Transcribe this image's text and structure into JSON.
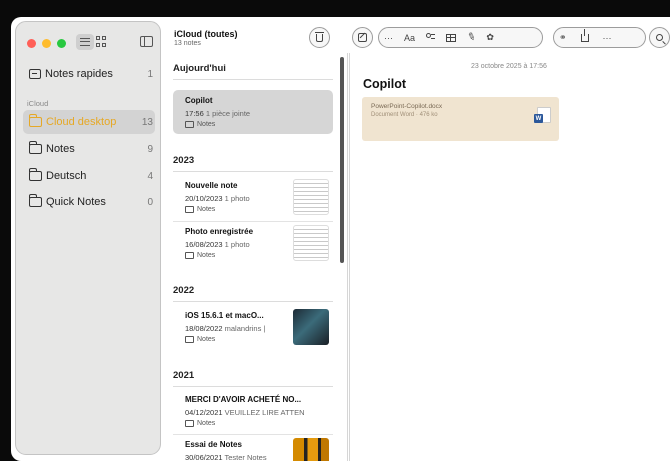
{
  "sidebar": {
    "section_label": "iCloud",
    "items": [
      {
        "label": "Notes rapides",
        "count": "1"
      },
      {
        "label": "Cloud desktop",
        "count": "13"
      },
      {
        "label": "Notes",
        "count": "9"
      },
      {
        "label": "Deutsch",
        "count": "4"
      },
      {
        "label": "Quick Notes",
        "count": "0"
      }
    ]
  },
  "list": {
    "title": "iCloud (toutes)",
    "subtitle": "13 notes",
    "groups": [
      {
        "header": "Aujourd'hui"
      },
      {
        "header": "2023"
      },
      {
        "header": "2022"
      },
      {
        "header": "2021"
      }
    ],
    "notes": [
      {
        "title": "Copilot",
        "date": "17:56",
        "extra": "1 pièce jointe",
        "folder": "Notes"
      },
      {
        "title": "Nouvelle note",
        "date": "20/10/2023",
        "extra": "1 photo",
        "folder": "Notes"
      },
      {
        "title": "Photo enregistrée",
        "date": "16/08/2023",
        "extra": "1 photo",
        "folder": "Notes"
      },
      {
        "title": "iOS 15.6.1 et macO...",
        "date": "18/08/2022",
        "extra": "malandrins |",
        "folder": "Notes"
      },
      {
        "title": "MERCI D'AVOIR ACHETÉ NO...",
        "date": "04/12/2021",
        "extra": "VEUILLEZ LIRE ATTEN",
        "folder": "Notes"
      },
      {
        "title": "Essai de Notes",
        "date": "30/06/2021",
        "extra": "Tester Notes",
        "folder": "Notes"
      }
    ]
  },
  "toolbar": {
    "format_label": "Aa",
    "more_label": "···"
  },
  "editor": {
    "date": "23 octobre 2025 à 17:56",
    "title": "Copilot",
    "attachment": {
      "name": "PowerPoint-Copilot.docx",
      "meta": "Document Word · 476 ko",
      "icon_letter": "W"
    }
  },
  "colors": {
    "accent": "#e6a825",
    "attachment_bg": "#f0e4d0",
    "word_blue": "#2b579a"
  }
}
